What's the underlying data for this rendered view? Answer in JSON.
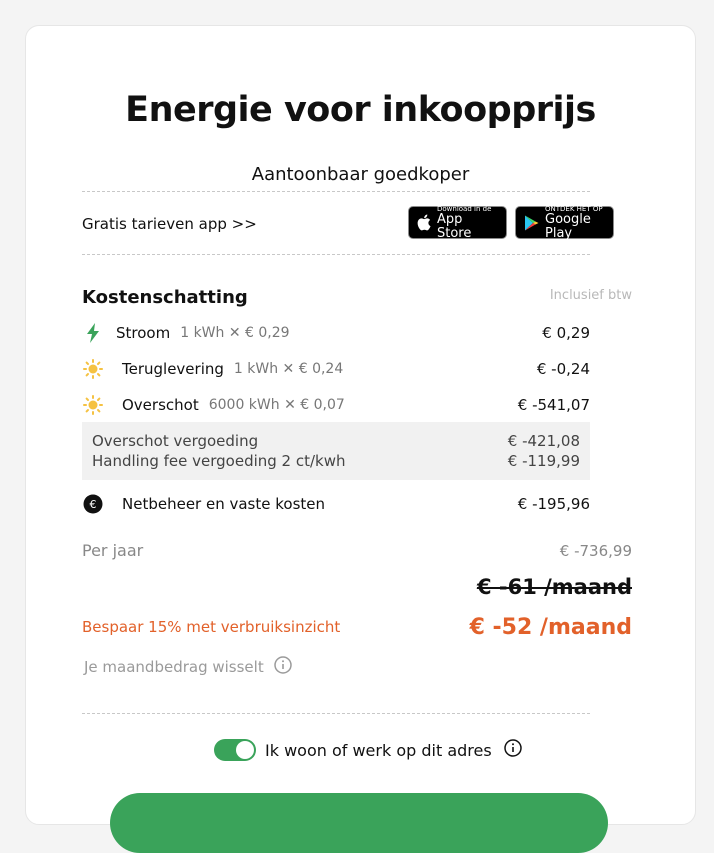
{
  "header": {
    "title": "Energie voor inkoopprijs",
    "subtitle": "Aantoonbaar goedkoper"
  },
  "app_promo": {
    "label": "Gratis tarieven app >>",
    "app_store": {
      "small": "Download in de",
      "big": "App Store"
    },
    "google_play": {
      "small": "ONTDEK HET OP",
      "big": "Google Play"
    }
  },
  "costs": {
    "title": "Kostenschatting",
    "incl_note": "Inclusief btw",
    "rows": [
      {
        "icon": "lightning-icon",
        "label": "Stroom",
        "detail": "1 kWh ✕ € 0,29",
        "amount": "€ 0,29"
      },
      {
        "icon": "sun-icon",
        "label": "Teruglevering",
        "detail": "1 kWh ✕ € 0,24",
        "amount": "€ -0,24"
      },
      {
        "icon": "sun-icon",
        "label": "Overschot",
        "detail": "6000 kWh ✕ € 0,07",
        "amount": "€ -541,07"
      }
    ],
    "sub": [
      {
        "label": "Overschot vergoeding",
        "amount": "€ -421,08"
      },
      {
        "label": "Handling fee vergoeding 2 ct/kwh",
        "amount": "€ -119,99"
      }
    ],
    "netbeheer": {
      "icon": "euro-coin-icon",
      "label": "Netbeheer en vaste kosten",
      "amount": "€ -195,96"
    },
    "per_jaar": {
      "label": "Per jaar",
      "amount": "€ -736,99"
    },
    "old_price": "€ -61 /maand",
    "save_label": "Bespaar 15% met verbruiksinzicht",
    "new_price": "€ -52 /maand",
    "note": "Je maandbedrag wisselt"
  },
  "address_toggle": {
    "label": "Ik woon of werk op dit adres",
    "checked": true
  },
  "colors": {
    "accent_green": "#3aa35a",
    "orange": "#e2612a"
  }
}
